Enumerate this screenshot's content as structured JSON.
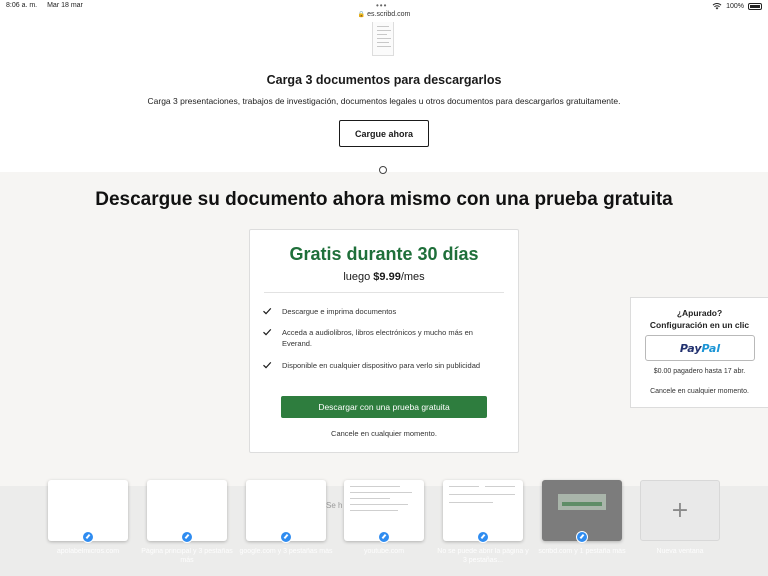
{
  "status_bar": {
    "time": "8:06 a. m.",
    "date": "Mar 18 mar",
    "url": "es.scribd.com",
    "battery": "100%"
  },
  "upload": {
    "title": "Carga 3 documentos para descargarlos",
    "description": "Carga 3 presentaciones, trabajos de investigación, documentos legales u otros documentos para descargarlos gratuitamente.",
    "button_label": "Cargue ahora"
  },
  "main_heading": "Descargue su documento ahora mismo con una prueba gratuita",
  "trial": {
    "title": "Gratis durante 30 días",
    "price_prefix": "luego ",
    "price": "$9.99",
    "price_suffix": "/mes",
    "features": [
      "Descargue e imprima documentos",
      "Acceda a audiolibros, libros electrónicos y mucho más en Everand.",
      "Disponible en cualquier dispositivo para verlo sin publicidad"
    ],
    "cta_label": "Descargar con una prueba gratuita",
    "cancel_note": "Cancele en cualquier momento."
  },
  "paypal": {
    "title_line1": "¿Apurado?",
    "title_line2": "Configuración en un clic",
    "logo_part1": "Pay",
    "logo_part2": "Pal",
    "note": "$0.00 pagadero hasta 17 abr.",
    "cancel_note": "Cancele en cualquier momento."
  },
  "tabs": {
    "ghost_text": "Se h",
    "items": [
      {
        "label": "apolabelmicros.com"
      },
      {
        "label": "Página principal y 3 pestañas más"
      },
      {
        "label": "google.com y 3 pestañas más"
      },
      {
        "label": "youtube.com"
      },
      {
        "label": "No se puede abrir la página y 3 pestañas..."
      },
      {
        "label": "scribd.com y 1 pestaña más"
      },
      {
        "label": "Nueva ventana"
      }
    ]
  },
  "colors": {
    "brand_green": "#1f6f3a",
    "cta_green": "#2e7d3e",
    "paypal_dark": "#22316f",
    "paypal_light": "#1b95d6"
  }
}
